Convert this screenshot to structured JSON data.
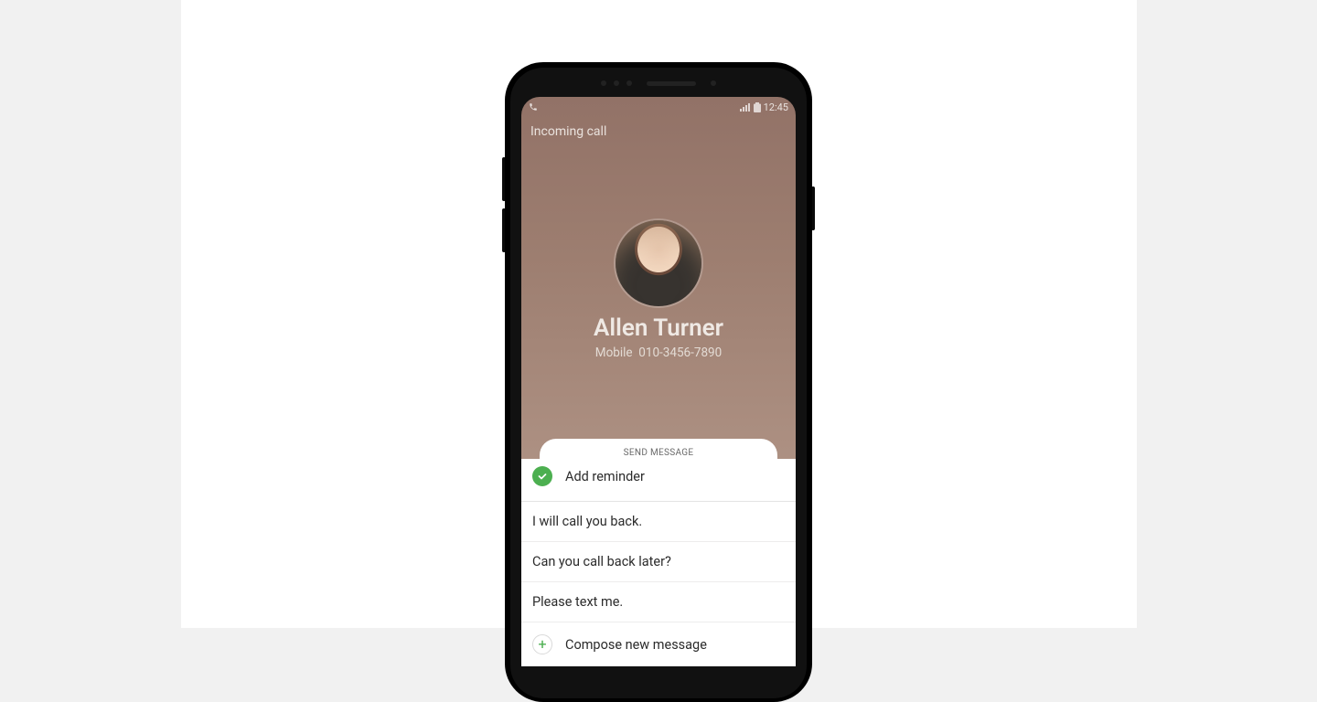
{
  "status_bar": {
    "time": "12:45"
  },
  "call": {
    "incoming_label": "Incoming call",
    "caller_name": "Allen Turner",
    "type_label": "Mobile",
    "number": "010-3456-7890"
  },
  "panel": {
    "tab_label": "SEND MESSAGE",
    "add_reminder_label": "Add reminder",
    "quick_replies": [
      "I will call you back.",
      "Can you call back later?",
      "Please text me."
    ],
    "compose_label": "Compose new message"
  }
}
